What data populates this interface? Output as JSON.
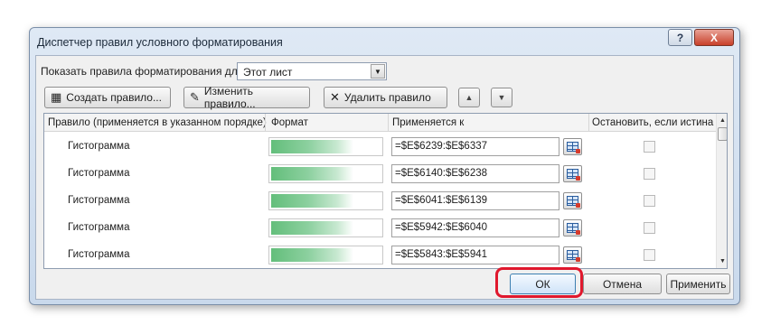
{
  "window": {
    "title": "Диспетчер правил условного форматирования",
    "help_label": "?",
    "close_label": "X"
  },
  "filter": {
    "label": "Показать правила форматирования для:",
    "selected": "Этот лист"
  },
  "toolbar": {
    "create_label": "Создать правило...",
    "edit_label": "Изменить правило...",
    "delete_label": "Удалить правило"
  },
  "grid": {
    "headers": {
      "rule": "Правило (применяется в указанном порядке)",
      "format": "Формат",
      "applies_to": "Применяется к",
      "stop": "Остановить, если истина"
    },
    "rows": [
      {
        "rule": "Гистограмма",
        "range": "=$E$6239:$E$6337",
        "stop": false
      },
      {
        "rule": "Гистограмма",
        "range": "=$E$6140:$E$6238",
        "stop": false
      },
      {
        "rule": "Гистограмма",
        "range": "=$E$6041:$E$6139",
        "stop": false
      },
      {
        "rule": "Гистограмма",
        "range": "=$E$5942:$E$6040",
        "stop": false
      },
      {
        "rule": "Гистограмма",
        "range": "=$E$5843:$E$5941",
        "stop": false
      }
    ]
  },
  "footer": {
    "ok_label": "ОК",
    "cancel_label": "Отмена",
    "apply_label": "Применить"
  },
  "colors": {
    "highlight": "#e0182d",
    "databar": "#63be7b"
  }
}
